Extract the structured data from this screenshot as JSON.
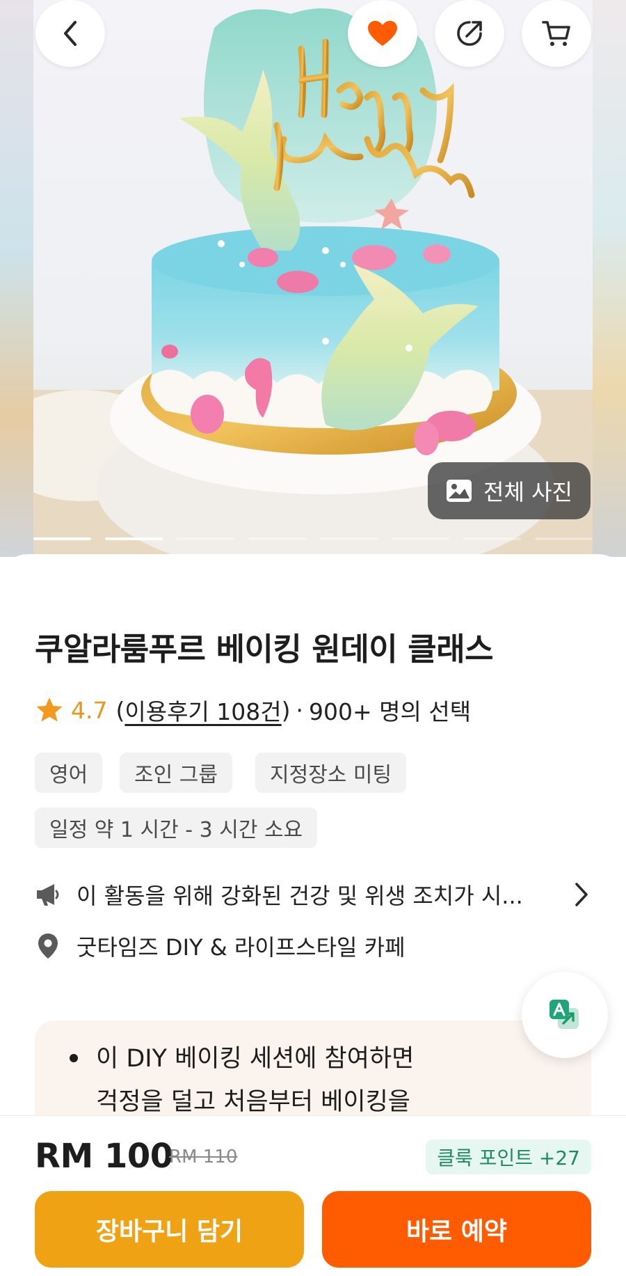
{
  "hero": {
    "all_photos_label": "전체 사진",
    "slide_count": 8,
    "active_slides": [
      0,
      1
    ]
  },
  "top_actions": {
    "back_icon": "chevron-left-icon",
    "wishlist_icon": "heart-icon",
    "share_icon": "share-icon",
    "cart_icon": "cart-icon"
  },
  "colors": {
    "accent": "#ff5b00",
    "heart": "#ff5b00",
    "rating_star": "#f39a1e",
    "cart_button": "#f0a215",
    "points_text": "#1e8a63"
  },
  "activity": {
    "title": "쿠알라룸푸르 베이킹 원데이 클래스",
    "rating": "4.7",
    "paren_open": "(",
    "reviews": "이용후기 108건",
    "paren_close": ")",
    "separator": "·",
    "participants": "900+ 명의 선택",
    "tags": [
      "영어",
      "조인 그룹",
      "지정장소 미팅",
      "일정 약 1 시간  - 3 시간  소요"
    ],
    "notice": "이 활동을 위해 강화된 건강 및 위생 조치가 시...",
    "location": "굿타임즈 DIY & 라이프스타일 카페",
    "description_lines": [
      "이 DIY 베이킹 세션에 참여하면",
      "걱정을 덜고 처음부터 베이킹을"
    ]
  },
  "purchase": {
    "price": "RM 100",
    "original_price": "RM 110",
    "points": "클룩 포인트 +27",
    "add_to_cart": "장바구니 담기",
    "book_now": "바로 예약"
  }
}
